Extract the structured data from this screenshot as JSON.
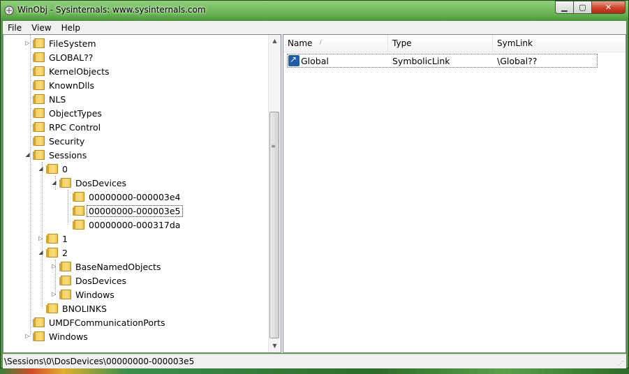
{
  "window": {
    "title": "WinObj - Sysinternals: www.sysinternals.com",
    "min_glyph": "▁",
    "max_glyph": "▢",
    "close_glyph": "✕"
  },
  "menu": {
    "items": [
      "File",
      "View",
      "Help"
    ]
  },
  "tree": {
    "nodes": [
      {
        "label": "FileSystem",
        "expander": "▷"
      },
      {
        "label": "GLOBAL??",
        "expander": ""
      },
      {
        "label": "KernelObjects",
        "expander": ""
      },
      {
        "label": "KnownDlls",
        "expander": ""
      },
      {
        "label": "NLS",
        "expander": ""
      },
      {
        "label": "ObjectTypes",
        "expander": ""
      },
      {
        "label": "RPC Control",
        "expander": ""
      },
      {
        "label": "Security",
        "expander": ""
      },
      {
        "label": "Sessions",
        "expander": "◢"
      },
      {
        "label": "0",
        "expander": "◢"
      },
      {
        "label": "DosDevices",
        "expander": "◢"
      },
      {
        "label": "00000000-000003e4",
        "expander": ""
      },
      {
        "label": "00000000-000003e5",
        "expander": "",
        "selected": true
      },
      {
        "label": "00000000-000317da",
        "expander": ""
      },
      {
        "label": "1",
        "expander": "▷"
      },
      {
        "label": "2",
        "expander": "◢"
      },
      {
        "label": "BaseNamedObjects",
        "expander": "▷"
      },
      {
        "label": "DosDevices",
        "expander": ""
      },
      {
        "label": "Windows",
        "expander": "▷"
      },
      {
        "label": "BNOLINKS",
        "expander": ""
      },
      {
        "label": "UMDFCommunicationPorts",
        "expander": ""
      },
      {
        "label": "Windows",
        "expander": "▷"
      }
    ],
    "scroll_up_glyph": "▲",
    "scroll_down_glyph": "▼",
    "thumb_grip_glyph": "≡"
  },
  "list": {
    "columns": {
      "name": "Name",
      "type": "Type",
      "symlink": "SymLink"
    },
    "sort_glyph": "/",
    "rows": [
      {
        "name": "Global",
        "type": "SymbolicLink",
        "symlink": "\\Global??",
        "icon": "symlink-icon"
      }
    ]
  },
  "status": {
    "path": "\\Sessions\\0\\DosDevices\\00000000-000003e5"
  },
  "colors": {
    "title_bar": "#66b152",
    "close_button": "#c8432a",
    "folder": "#f3d36a"
  }
}
